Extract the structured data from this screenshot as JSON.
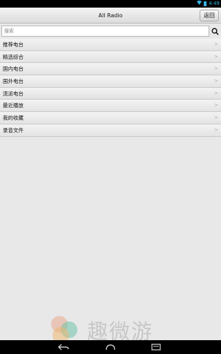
{
  "status_bar": {
    "time": "4:49"
  },
  "header": {
    "title": "All Radio",
    "back_label": "返回"
  },
  "search": {
    "placeholder": "搜索",
    "value": ""
  },
  "list": {
    "items": [
      {
        "label": "推荐电台",
        "chevron": ">"
      },
      {
        "label": "精选综合",
        "chevron": ">"
      },
      {
        "label": "国内电台",
        "chevron": ">"
      },
      {
        "label": "国外电台",
        "chevron": ">"
      },
      {
        "label": "流派电台",
        "chevron": ">"
      },
      {
        "label": "最近播放",
        "chevron": ">"
      },
      {
        "label": "我的收藏",
        "chevron": ">"
      },
      {
        "label": "录音文件",
        "chevron": ">"
      }
    ]
  },
  "watermark": {
    "text": "趣微游"
  },
  "colors": {
    "status_accent": "#33b5e5",
    "background": "#e8e8e8"
  },
  "icons": {
    "search": "search-icon",
    "back": "back-nav-icon",
    "home": "home-nav-icon",
    "recents": "recents-nav-icon"
  }
}
